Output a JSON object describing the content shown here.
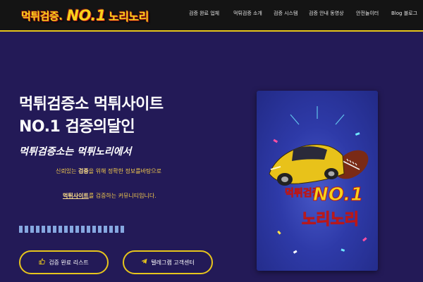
{
  "header": {
    "logo": {
      "part1": "먹튀검증.",
      "part2": "NO.1",
      "part3": "노리노리"
    },
    "nav": [
      {
        "label": "검증 완료 업체"
      },
      {
        "label": "먹튀검증 소개"
      },
      {
        "label": "검증 시스템"
      },
      {
        "label": "검증 안내 동영상"
      },
      {
        "label": "안전놀이터"
      },
      {
        "label": "Blog 블로그"
      }
    ]
  },
  "hero": {
    "title_line1": "먹튀검증소 먹튀사이트",
    "title_line2": "NO.1 검증의달인",
    "subtitle": "먹튀검증소는 먹튀노리에서",
    "desc1": {
      "before": "신뢰있는 ",
      "bold": "검증",
      "after": "을 위해 정확한 정보를바탕으로"
    },
    "desc2": {
      "bold": "먹튀사이트",
      "after": "를 검증하는 커뮤니티입니다."
    },
    "stripe_count": 19
  },
  "buttons": {
    "list": {
      "icon": "thumbs-up-icon",
      "label": "검증 완료 리스트"
    },
    "telegram": {
      "icon": "telegram-icon",
      "label": "텔레그램 고객센터"
    }
  },
  "banner": {
    "text_top": "먹튀검증",
    "text_no1": "NO.1",
    "text_bottom": "노리노리"
  },
  "colors": {
    "background": "#231a57",
    "header": "#141414",
    "accent": "#e7c51c",
    "desc_text": "#f2c94c"
  }
}
